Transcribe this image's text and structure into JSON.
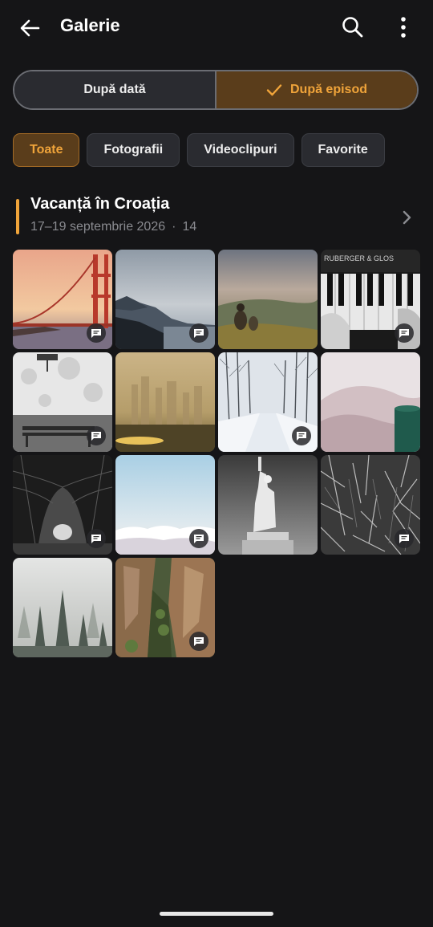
{
  "appbar": {
    "title": "Galerie",
    "back_icon": "arrow-left-icon",
    "search_icon": "search-icon",
    "more_icon": "more-vertical-icon"
  },
  "segmented": {
    "by_date": "După dată",
    "by_episode": "După episod",
    "selected": "by_episode"
  },
  "filters": {
    "items": [
      "Toate",
      "Fotografii",
      "Videoclipuri",
      "Favorite"
    ],
    "selected": "Toate"
  },
  "episode": {
    "title": "Vacanță în Croația",
    "dates": "17–19 septembrie 2026",
    "separator": "·",
    "count": "14"
  },
  "photos": [
    {
      "subject": "golden-gate-bridge-sunset",
      "has_comment": true
    },
    {
      "subject": "coastal-mountains-mist",
      "has_comment": true
    },
    {
      "subject": "people-on-hill-overlook",
      "has_comment": false
    },
    {
      "subject": "piano-keys-bw",
      "has_comment": true
    },
    {
      "subject": "snowy-bench-bw",
      "has_comment": true
    },
    {
      "subject": "foggy-city-skyline",
      "has_comment": false
    },
    {
      "subject": "snowy-forest-path",
      "has_comment": true
    },
    {
      "subject": "blanket-and-mug",
      "has_comment": false
    },
    {
      "subject": "tree-tunnel-bw",
      "has_comment": true
    },
    {
      "subject": "sky-above-clouds",
      "has_comment": true
    },
    {
      "subject": "statue-of-liberty-bw",
      "has_comment": false
    },
    {
      "subject": "dry-grass-bw",
      "has_comment": true
    },
    {
      "subject": "misty-pine-forest",
      "has_comment": false
    },
    {
      "subject": "rock-cliffs-forest",
      "has_comment": true
    }
  ],
  "colors": {
    "background": "#151517",
    "accent": "#f0a43a",
    "accent_bg": "#5a3d1b",
    "chip_bg": "#2a2b30"
  }
}
